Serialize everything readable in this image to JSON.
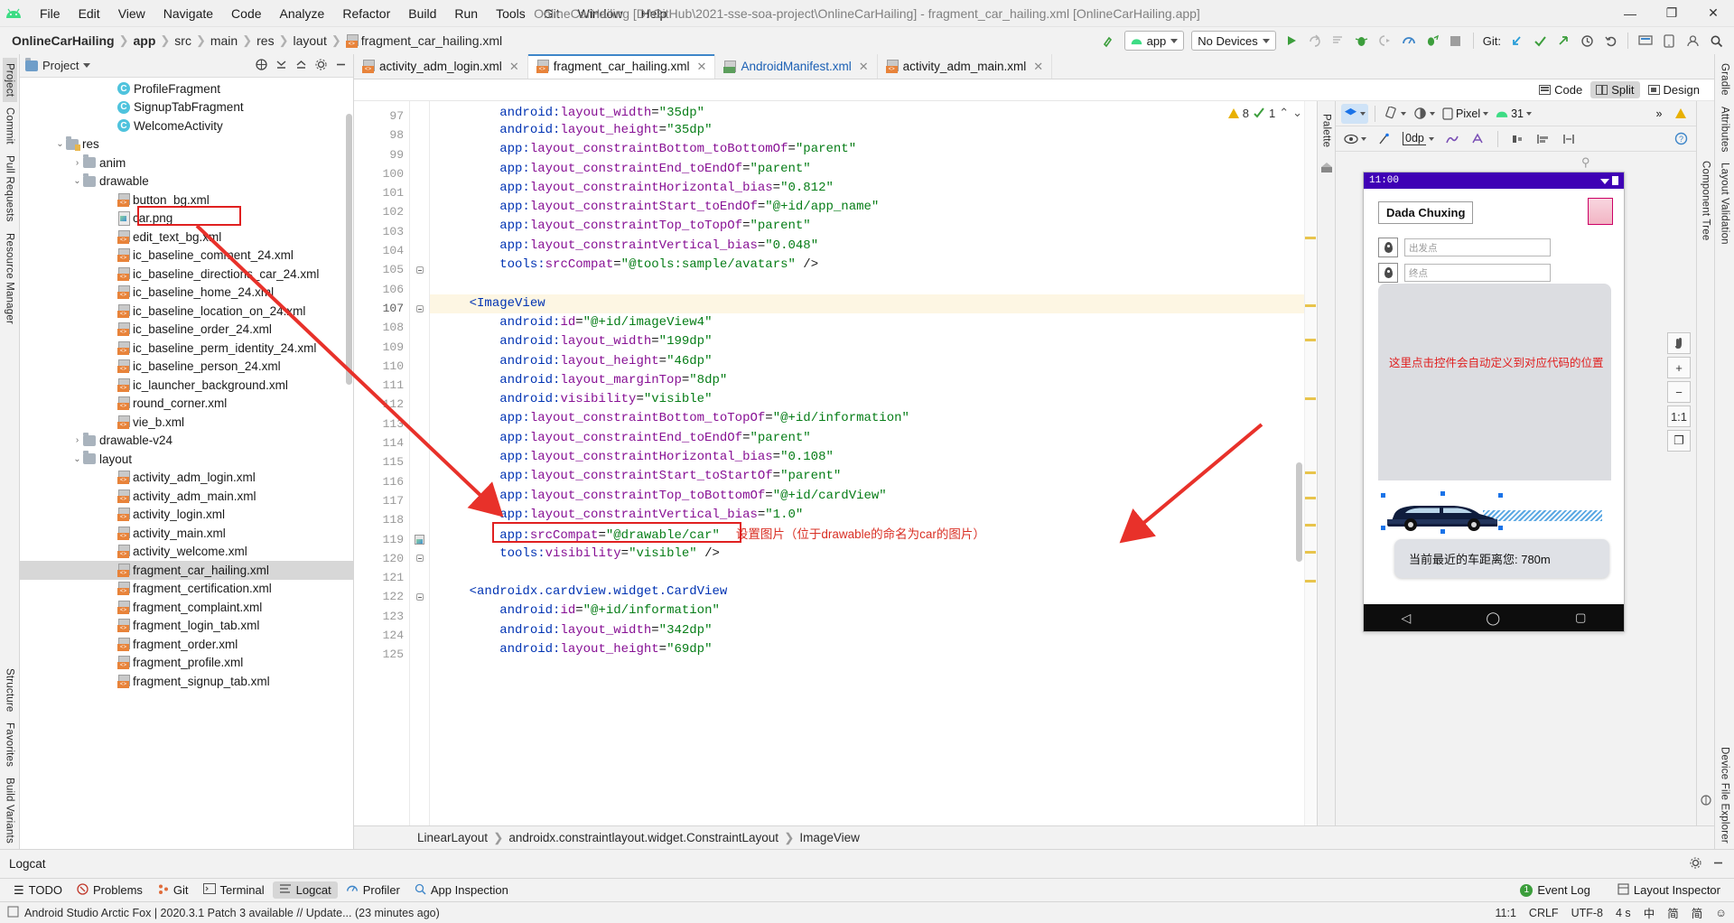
{
  "window": {
    "title": "OnlineCarHailing [D:\\GitHub\\2021-sse-soa-project\\OnlineCarHailing] - fragment_car_hailing.xml [OnlineCarHailing.app]",
    "minimize": "—",
    "maximize": "❐",
    "close": "✕"
  },
  "menu": [
    "File",
    "Edit",
    "View",
    "Navigate",
    "Code",
    "Analyze",
    "Refactor",
    "Build",
    "Run",
    "Tools",
    "Git",
    "Window",
    "Help"
  ],
  "breadcrumbs": [
    "OnlineCarHailing",
    "app",
    "src",
    "main",
    "res",
    "layout",
    "fragment_car_hailing.xml"
  ],
  "toolbar": {
    "module": "app",
    "device": "No Devices",
    "git_label": "Git:"
  },
  "project": {
    "title": "Project",
    "tree": [
      {
        "label": "ProfileFragment",
        "icon": "class-icon",
        "indent": 5,
        "arrow": ""
      },
      {
        "label": "SignupTabFragment",
        "icon": "class-icon",
        "indent": 5,
        "arrow": ""
      },
      {
        "label": "WelcomeActivity",
        "icon": "class-icon",
        "indent": 5,
        "arrow": ""
      },
      {
        "label": "res",
        "icon": "folder-res-icon",
        "indent": 2,
        "arrow": "v"
      },
      {
        "label": "anim",
        "icon": "folder-icon",
        "indent": 3,
        "arrow": ">"
      },
      {
        "label": "drawable",
        "icon": "folder-icon",
        "indent": 3,
        "arrow": "v"
      },
      {
        "label": "button_bg.xml",
        "icon": "xml-icon",
        "indent": 5,
        "arrow": ""
      },
      {
        "label": "car.png",
        "icon": "png-icon",
        "indent": 5,
        "arrow": "",
        "highlight": true
      },
      {
        "label": "edit_text_bg.xml",
        "icon": "xml-icon",
        "indent": 5,
        "arrow": ""
      },
      {
        "label": "ic_baseline_comment_24.xml",
        "icon": "xml-icon",
        "indent": 5,
        "arrow": ""
      },
      {
        "label": "ic_baseline_directions_car_24.xml",
        "icon": "xml-icon",
        "indent": 5,
        "arrow": ""
      },
      {
        "label": "ic_baseline_home_24.xml",
        "icon": "xml-icon",
        "indent": 5,
        "arrow": ""
      },
      {
        "label": "ic_baseline_location_on_24.xml",
        "icon": "xml-icon",
        "indent": 5,
        "arrow": ""
      },
      {
        "label": "ic_baseline_order_24.xml",
        "icon": "xml-icon",
        "indent": 5,
        "arrow": ""
      },
      {
        "label": "ic_baseline_perm_identity_24.xml",
        "icon": "xml-icon",
        "indent": 5,
        "arrow": ""
      },
      {
        "label": "ic_baseline_person_24.xml",
        "icon": "xml-icon",
        "indent": 5,
        "arrow": ""
      },
      {
        "label": "ic_launcher_background.xml",
        "icon": "xml-icon",
        "indent": 5,
        "arrow": ""
      },
      {
        "label": "round_corner.xml",
        "icon": "xml-icon",
        "indent": 5,
        "arrow": ""
      },
      {
        "label": "vie_b.xml",
        "icon": "xml-icon",
        "indent": 5,
        "arrow": ""
      },
      {
        "label": "drawable-v24",
        "icon": "folder-icon",
        "indent": 3,
        "arrow": ">"
      },
      {
        "label": "layout",
        "icon": "folder-icon",
        "indent": 3,
        "arrow": "v"
      },
      {
        "label": "activity_adm_login.xml",
        "icon": "xml-icon",
        "indent": 5,
        "arrow": ""
      },
      {
        "label": "activity_adm_main.xml",
        "icon": "xml-icon",
        "indent": 5,
        "arrow": ""
      },
      {
        "label": "activity_login.xml",
        "icon": "xml-icon",
        "indent": 5,
        "arrow": ""
      },
      {
        "label": "activity_main.xml",
        "icon": "xml-icon",
        "indent": 5,
        "arrow": ""
      },
      {
        "label": "activity_welcome.xml",
        "icon": "xml-icon",
        "indent": 5,
        "arrow": ""
      },
      {
        "label": "fragment_car_hailing.xml",
        "icon": "xml-icon",
        "indent": 5,
        "arrow": "",
        "selected": true
      },
      {
        "label": "fragment_certification.xml",
        "icon": "xml-icon",
        "indent": 5,
        "arrow": ""
      },
      {
        "label": "fragment_complaint.xml",
        "icon": "xml-icon",
        "indent": 5,
        "arrow": ""
      },
      {
        "label": "fragment_login_tab.xml",
        "icon": "xml-icon",
        "indent": 5,
        "arrow": ""
      },
      {
        "label": "fragment_order.xml",
        "icon": "xml-icon",
        "indent": 5,
        "arrow": ""
      },
      {
        "label": "fragment_profile.xml",
        "icon": "xml-icon",
        "indent": 5,
        "arrow": ""
      },
      {
        "label": "fragment_signup_tab.xml",
        "icon": "xml-icon",
        "indent": 5,
        "arrow": ""
      }
    ]
  },
  "left_strip": [
    "Project",
    "Commit",
    "Pull Requests",
    "Resource Manager",
    "Structure",
    "Favorites",
    "Build Variants"
  ],
  "right_strip": [
    "Gradle",
    "Attributes",
    "Layout Validation",
    "Device File Explorer"
  ],
  "editor": {
    "tabs": [
      {
        "label": "activity_adm_login.xml",
        "active": false
      },
      {
        "label": "fragment_car_hailing.xml",
        "active": true
      },
      {
        "label": "AndroidManifest.xml",
        "active": false,
        "icon": "manifest-icon"
      },
      {
        "label": "activity_adm_main.xml",
        "active": false
      }
    ],
    "view_modes": [
      {
        "label": "Code",
        "selected": false
      },
      {
        "label": "Split",
        "selected": true
      },
      {
        "label": "Design",
        "selected": false
      }
    ],
    "hints": {
      "warning_count": "8",
      "weak_count": "1"
    },
    "first_line": 97,
    "lines": [
      {
        "n": 97,
        "text": "        android:layout_width=\"35dp\"",
        "clipped": true
      },
      {
        "n": 98,
        "text": "        android:layout_height=\"35dp\""
      },
      {
        "n": 99,
        "text": "        app:layout_constraintBottom_toBottomOf=\"parent\""
      },
      {
        "n": 100,
        "text": "        app:layout_constraintEnd_toEndOf=\"parent\""
      },
      {
        "n": 101,
        "text": "        app:layout_constraintHorizontal_bias=\"0.812\""
      },
      {
        "n": 102,
        "text": "        app:layout_constraintStart_toEndOf=\"@+id/app_name\""
      },
      {
        "n": 103,
        "text": "        app:layout_constraintTop_toTopOf=\"parent\""
      },
      {
        "n": 104,
        "text": "        app:layout_constraintVertical_bias=\"0.048\""
      },
      {
        "n": 105,
        "text": "        tools:srcCompat=\"@tools:sample/avatars\" />",
        "fold": true
      },
      {
        "n": 106,
        "text": ""
      },
      {
        "n": 107,
        "text": "    <ImageView",
        "highlight": true,
        "fold": true
      },
      {
        "n": 108,
        "text": "        android:id=\"@+id/imageView4\""
      },
      {
        "n": 109,
        "text": "        android:layout_width=\"199dp\""
      },
      {
        "n": 110,
        "text": "        android:layout_height=\"46dp\""
      },
      {
        "n": 111,
        "text": "        android:layout_marginTop=\"8dp\""
      },
      {
        "n": 112,
        "text": "        android:visibility=\"visible\""
      },
      {
        "n": 113,
        "text": "        app:layout_constraintBottom_toTopOf=\"@+id/information\""
      },
      {
        "n": 114,
        "text": "        app:layout_constraintEnd_toEndOf=\"parent\""
      },
      {
        "n": 115,
        "text": "        app:layout_constraintHorizontal_bias=\"0.108\""
      },
      {
        "n": 116,
        "text": "        app:layout_constraintStart_toStartOf=\"parent\""
      },
      {
        "n": 117,
        "text": "        app:layout_constraintTop_toBottomOf=\"@+id/cardView\""
      },
      {
        "n": 118,
        "text": "        app:layout_constraintVertical_bias=\"1.0\""
      },
      {
        "n": 119,
        "text": "        app:srcCompat=\"@drawable/car\"",
        "boxed": true,
        "gutter_img": true,
        "annotation": "设置图片（位于drawable的命名为car的图片）"
      },
      {
        "n": 120,
        "text": "        tools:visibility=\"visible\" />",
        "fold": true
      },
      {
        "n": 121,
        "text": ""
      },
      {
        "n": 122,
        "text": "    <androidx.cardview.widget.CardView",
        "fold": true
      },
      {
        "n": 123,
        "text": "        android:id=\"@+id/information\""
      },
      {
        "n": 124,
        "text": "        android:layout_width=\"342dp\""
      },
      {
        "n": 125,
        "text": "        android:layout_height=\"69dp\""
      }
    ],
    "breadcrumb_path": [
      "LinearLayout",
      "androidx.constraintlayout.widget.ConstraintLayout",
      "ImageView"
    ]
  },
  "design": {
    "device": "Pixel",
    "api": "31",
    "margin_value": "0dp",
    "preview": {
      "status_time": "11:00",
      "app_name": "Dada Chuxing",
      "start_placeholder": "出发点",
      "end_placeholder": "终点",
      "map_note": "这里点击控件会自动定义到对应代码的位置",
      "card_text": "当前最近的车距离您: 780m"
    },
    "zoom_controls": [
      "+",
      "−",
      "1:1",
      "❐"
    ]
  },
  "annotations": {
    "code_note": "设置图片（位于drawable的命名为car的图片）"
  },
  "bottom": {
    "logcat_title": "Logcat",
    "tool_tabs": [
      {
        "label": "TODO",
        "icon": "todo-icon"
      },
      {
        "label": "Problems",
        "icon": "problems-icon"
      },
      {
        "label": "Git",
        "icon": "git-icon"
      },
      {
        "label": "Terminal",
        "icon": "terminal-icon"
      },
      {
        "label": "Logcat",
        "icon": "logcat-icon",
        "selected": true
      },
      {
        "label": "Profiler",
        "icon": "profiler-icon"
      },
      {
        "label": "App Inspection",
        "icon": "app-inspection-icon"
      }
    ],
    "right_items": [
      {
        "label": "Event Log",
        "badge": "1"
      },
      {
        "label": "Layout Inspector",
        "badge": ""
      }
    ]
  },
  "status": {
    "message": "Android Studio Arctic Fox | 2020.3.1 Patch 3 available // Update... (23 minutes ago)",
    "caret": "11:1",
    "line_sep": "CRLF",
    "encoding": "UTF-8",
    "indent": "4 s",
    "ime": [
      "中",
      "简",
      "简",
      "☺"
    ]
  }
}
